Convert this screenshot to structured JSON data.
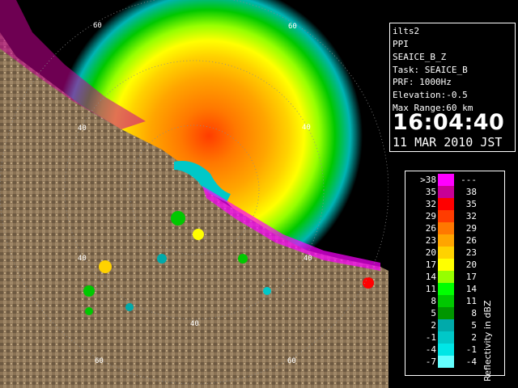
{
  "info": {
    "radar": "ilts2",
    "scan_type": "PPI",
    "product": "SEAICE_B_Z",
    "task": "Task: SEAICE_B",
    "prf": "PRF: 1000Hz",
    "elevation": "Elevation:-0.5",
    "max_range": "Max Range:60 km",
    "time": "16:04:40",
    "date": "11 MAR 2010 JST"
  },
  "range_labels": {
    "r60_top": "60",
    "r60_top_right": "60",
    "r40_upper_right": "40",
    "r40_left": "40",
    "r40_left_lower": "40",
    "r40_right": "40",
    "r40_bottom": "40",
    "r60_bottom_left": "60",
    "r60_bottom_right": "60",
    "r20_center": "40"
  },
  "legend": {
    "unit_label": "Reflectivity in dBZ",
    "rows": [
      {
        "left": ">38",
        "right": "---",
        "color": "#ff00ff"
      },
      {
        "left": "35",
        "right": "38",
        "color": "#c80096"
      },
      {
        "left": "32",
        "right": "35",
        "color": "#ff0000"
      },
      {
        "left": "29",
        "right": "32",
        "color": "#ff3c00"
      },
      {
        "left": "26",
        "right": "29",
        "color": "#ff7800"
      },
      {
        "left": "23",
        "right": "26",
        "color": "#ffa500"
      },
      {
        "left": "20",
        "right": "23",
        "color": "#ffd200"
      },
      {
        "left": "17",
        "right": "20",
        "color": "#ffff00"
      },
      {
        "left": "14",
        "right": "17",
        "color": "#96ff00"
      },
      {
        "left": "11",
        "right": "14",
        "color": "#00ff00"
      },
      {
        "left": "8",
        "right": "11",
        "color": "#00c800"
      },
      {
        "left": "5",
        "right": "8",
        "color": "#009600"
      },
      {
        "left": "2",
        "right": "5",
        "color": "#00aaaa"
      },
      {
        "left": "-1",
        "right": "2",
        "color": "#00c8c8"
      },
      {
        "left": "-4",
        "right": "-1",
        "color": "#00e6e6"
      },
      {
        "left": "-7",
        "right": "-4",
        "color": "#64ffff"
      }
    ]
  },
  "colors": {
    "land": "#8b7355",
    "land_dark": "#5a4632",
    "sea": "#000000",
    "range_ring": "#8c8c8c"
  }
}
